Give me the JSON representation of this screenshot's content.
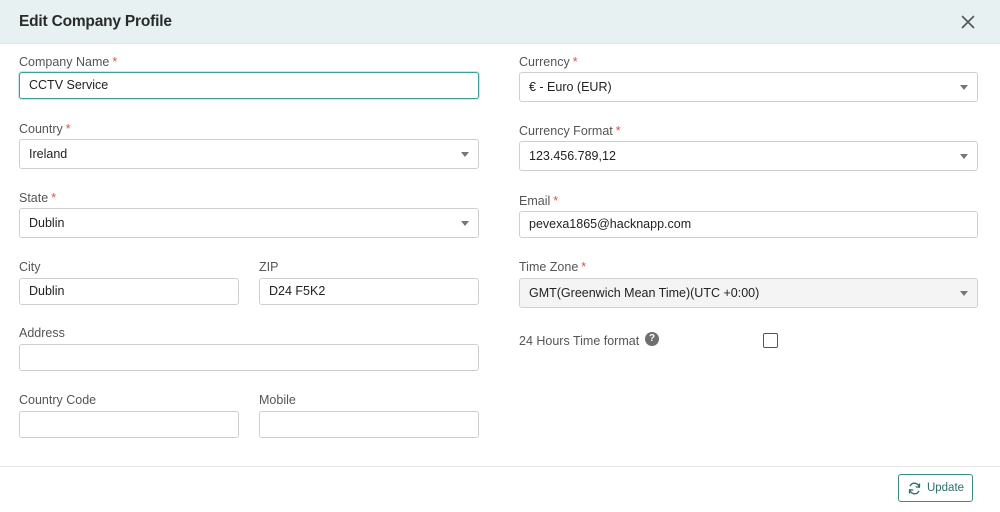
{
  "modal": {
    "title": "Edit Company Profile",
    "close_icon": "close-icon"
  },
  "form": {
    "required_mark": "*",
    "company_name": {
      "label": "Company Name",
      "value": "CCTV Service"
    },
    "country": {
      "label": "Country",
      "value": "Ireland"
    },
    "state": {
      "label": "State",
      "value": "Dublin"
    },
    "city": {
      "label": "City",
      "value": "Dublin"
    },
    "zip": {
      "label": "ZIP",
      "value": "D24 F5K2"
    },
    "address": {
      "label": "Address",
      "value": ""
    },
    "country_code": {
      "label": "Country Code",
      "value": ""
    },
    "mobile": {
      "label": "Mobile",
      "value": ""
    },
    "currency": {
      "label": "Currency",
      "value": "€ - Euro (EUR)"
    },
    "currency_format": {
      "label": "Currency Format",
      "value": "123.456.789,12"
    },
    "email": {
      "label": "Email",
      "value": "pevexa1865@hacknapp.com"
    },
    "time_zone": {
      "label": "Time Zone",
      "value": "GMT(Greenwich Mean Time)(UTC +0:00)"
    },
    "time_format": {
      "label": "24 Hours Time format",
      "help_glyph": "?",
      "checked": false
    }
  },
  "footer": {
    "update_label": "Update",
    "update_icon": "refresh-icon"
  },
  "colors": {
    "header_bg": "#e8f1f1",
    "accent": "#3d8c86",
    "required": "#d9534f"
  }
}
